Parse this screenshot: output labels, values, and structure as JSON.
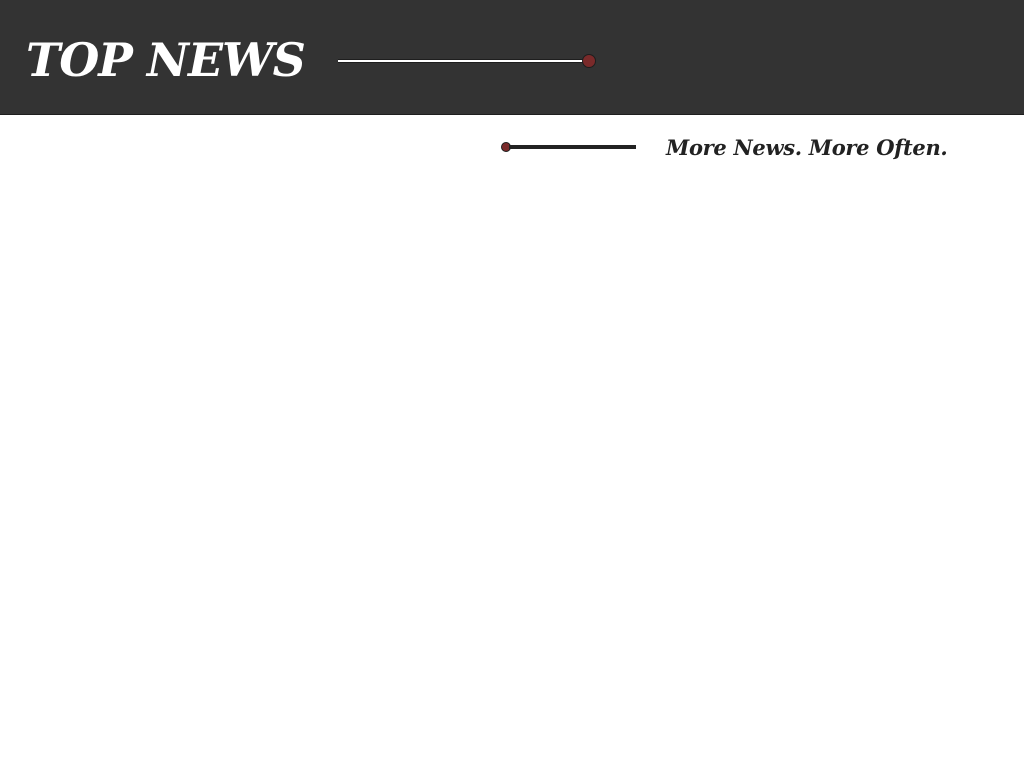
{
  "header": {
    "title": "TOP NEWS"
  },
  "tagline": {
    "text": "More News. More Often."
  },
  "colors": {
    "header_background": "#333333",
    "accent": "#7a2a2a",
    "title_text": "#ffffff",
    "tagline_text": "#222222"
  }
}
